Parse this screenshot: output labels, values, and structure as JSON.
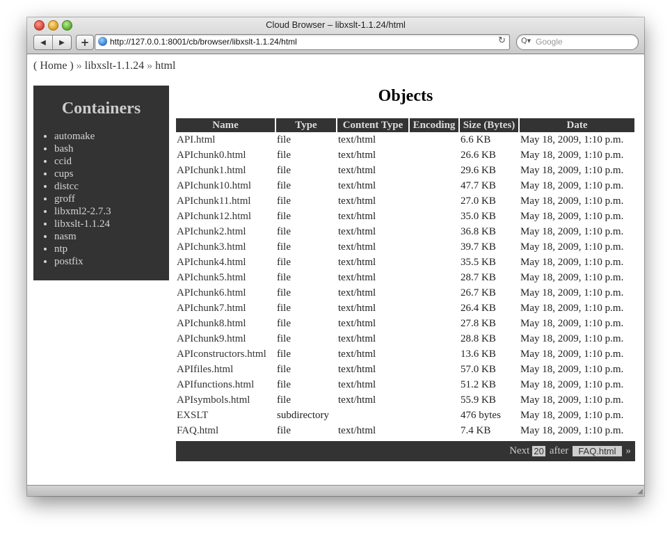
{
  "window": {
    "title": "Cloud Browser – libxslt-1.1.24/html",
    "url": "http://127.0.0.1:8001/cb/browser/libxslt-1.1.24/html",
    "search_placeholder": "Google",
    "back_glyph": "◀",
    "forward_glyph": "▶",
    "add_glyph": "+",
    "reload_glyph": "↻",
    "search_glyph": "Q▾"
  },
  "breadcrumb": {
    "home": "( Home )",
    "sep1": "»",
    "container": "libxslt-1.1.24",
    "sep2": "»",
    "current": "html"
  },
  "sidebar": {
    "title": "Containers",
    "items": [
      "automake",
      "bash",
      "ccid",
      "cups",
      "distcc",
      "groff",
      "libxml2-2.7.3",
      "libxslt-1.1.24",
      "nasm",
      "ntp",
      "postfix"
    ]
  },
  "main": {
    "title": "Objects",
    "columns": [
      "Name",
      "Type",
      "Content Type",
      "Encoding",
      "Size (Bytes)",
      "Date"
    ],
    "rows": [
      [
        "API.html",
        "file",
        "text/html",
        "",
        "6.6 KB",
        "May 18, 2009, 1:10 p.m."
      ],
      [
        "APIchunk0.html",
        "file",
        "text/html",
        "",
        "26.6 KB",
        "May 18, 2009, 1:10 p.m."
      ],
      [
        "APIchunk1.html",
        "file",
        "text/html",
        "",
        "29.6 KB",
        "May 18, 2009, 1:10 p.m."
      ],
      [
        "APIchunk10.html",
        "file",
        "text/html",
        "",
        "47.7 KB",
        "May 18, 2009, 1:10 p.m."
      ],
      [
        "APIchunk11.html",
        "file",
        "text/html",
        "",
        "27.0 KB",
        "May 18, 2009, 1:10 p.m."
      ],
      [
        "APIchunk12.html",
        "file",
        "text/html",
        "",
        "35.0 KB",
        "May 18, 2009, 1:10 p.m."
      ],
      [
        "APIchunk2.html",
        "file",
        "text/html",
        "",
        "36.8 KB",
        "May 18, 2009, 1:10 p.m."
      ],
      [
        "APIchunk3.html",
        "file",
        "text/html",
        "",
        "39.7 KB",
        "May 18, 2009, 1:10 p.m."
      ],
      [
        "APIchunk4.html",
        "file",
        "text/html",
        "",
        "35.5 KB",
        "May 18, 2009, 1:10 p.m."
      ],
      [
        "APIchunk5.html",
        "file",
        "text/html",
        "",
        "28.7 KB",
        "May 18, 2009, 1:10 p.m."
      ],
      [
        "APIchunk6.html",
        "file",
        "text/html",
        "",
        "26.7 KB",
        "May 18, 2009, 1:10 p.m."
      ],
      [
        "APIchunk7.html",
        "file",
        "text/html",
        "",
        "26.4 KB",
        "May 18, 2009, 1:10 p.m."
      ],
      [
        "APIchunk8.html",
        "file",
        "text/html",
        "",
        "27.8 KB",
        "May 18, 2009, 1:10 p.m."
      ],
      [
        "APIchunk9.html",
        "file",
        "text/html",
        "",
        "28.8 KB",
        "May 18, 2009, 1:10 p.m."
      ],
      [
        "APIconstructors.html",
        "file",
        "text/html",
        "",
        "13.6 KB",
        "May 18, 2009, 1:10 p.m."
      ],
      [
        "APIfiles.html",
        "file",
        "text/html",
        "",
        "57.0 KB",
        "May 18, 2009, 1:10 p.m."
      ],
      [
        "APIfunctions.html",
        "file",
        "text/html",
        "",
        "51.2 KB",
        "May 18, 2009, 1:10 p.m."
      ],
      [
        "APIsymbols.html",
        "file",
        "text/html",
        "",
        "55.9 KB",
        "May 18, 2009, 1:10 p.m."
      ],
      [
        "EXSLT",
        "subdirectory",
        "",
        "",
        "476 bytes",
        "May 18, 2009, 1:10 p.m."
      ],
      [
        "FAQ.html",
        "file",
        "text/html",
        "",
        "7.4 KB",
        "May 18, 2009, 1:10 p.m."
      ]
    ]
  },
  "pager": {
    "next_label": "Next",
    "count": "20",
    "after_label": "after",
    "after_file": "FAQ.html",
    "go_label": "»"
  },
  "colors": {
    "panel": "#333333",
    "panel_text": "#cccccc"
  }
}
